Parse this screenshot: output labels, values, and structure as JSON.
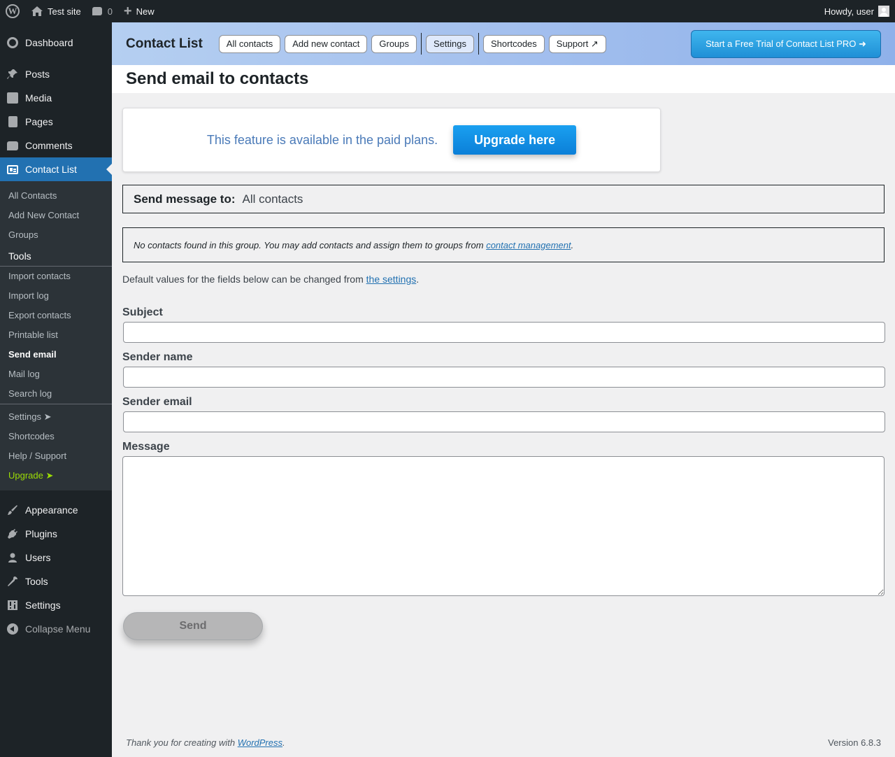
{
  "admin_bar": {
    "site_name": "Test site",
    "comments_count": "0",
    "new_label": "New",
    "greeting": "Howdy, user"
  },
  "sidebar": {
    "dashboard": "Dashboard",
    "posts": "Posts",
    "media": "Media",
    "pages": "Pages",
    "comments": "Comments",
    "contact_list": "Contact List",
    "submenu": {
      "all_contacts": "All Contacts",
      "add_new_contact": "Add New Contact",
      "groups": "Groups",
      "tools": "Tools",
      "import_contacts": "Import contacts",
      "import_log": "Import log",
      "export_contacts": "Export contacts",
      "printable_list": "Printable list",
      "send_email": "Send email",
      "mail_log": "Mail log",
      "search_log": "Search log",
      "settings": "Settings ➤",
      "shortcodes": "Shortcodes",
      "help_support": "Help / Support",
      "upgrade": "Upgrade ➤"
    },
    "appearance": "Appearance",
    "plugins": "Plugins",
    "users": "Users",
    "tools": "Tools",
    "settings": "Settings",
    "collapse": "Collapse Menu"
  },
  "plugin_header": {
    "title": "Contact List",
    "tabs": [
      "All contacts",
      "Add new contact",
      "Groups",
      "Settings",
      "Shortcodes",
      "Support ↗"
    ],
    "trial_button": "Start a Free Trial of Contact List PRO ➜"
  },
  "page": {
    "title": "Send email to contacts",
    "paid_notice": "This feature is available in the paid plans.",
    "upgrade_button": "Upgrade here",
    "send_to_label": "Send message to:",
    "send_to_value": "All contacts",
    "no_contacts_text": "No contacts found in this group. You may add contacts and assign them to groups from",
    "no_contacts_link": "contact management",
    "defaults_text": "Default values for the fields below can be changed from",
    "defaults_link": "the settings",
    "subject_label": "Subject",
    "subject_value": "",
    "sender_name_label": "Sender name",
    "sender_name_value": "",
    "sender_email_label": "Sender email",
    "sender_email_value": "",
    "message_label": "Message",
    "message_value": "",
    "send_button": "Send"
  },
  "footer": {
    "thanks_text": "Thank you for creating with",
    "thanks_link": "WordPress",
    "version": "Version 6.8.3"
  }
}
